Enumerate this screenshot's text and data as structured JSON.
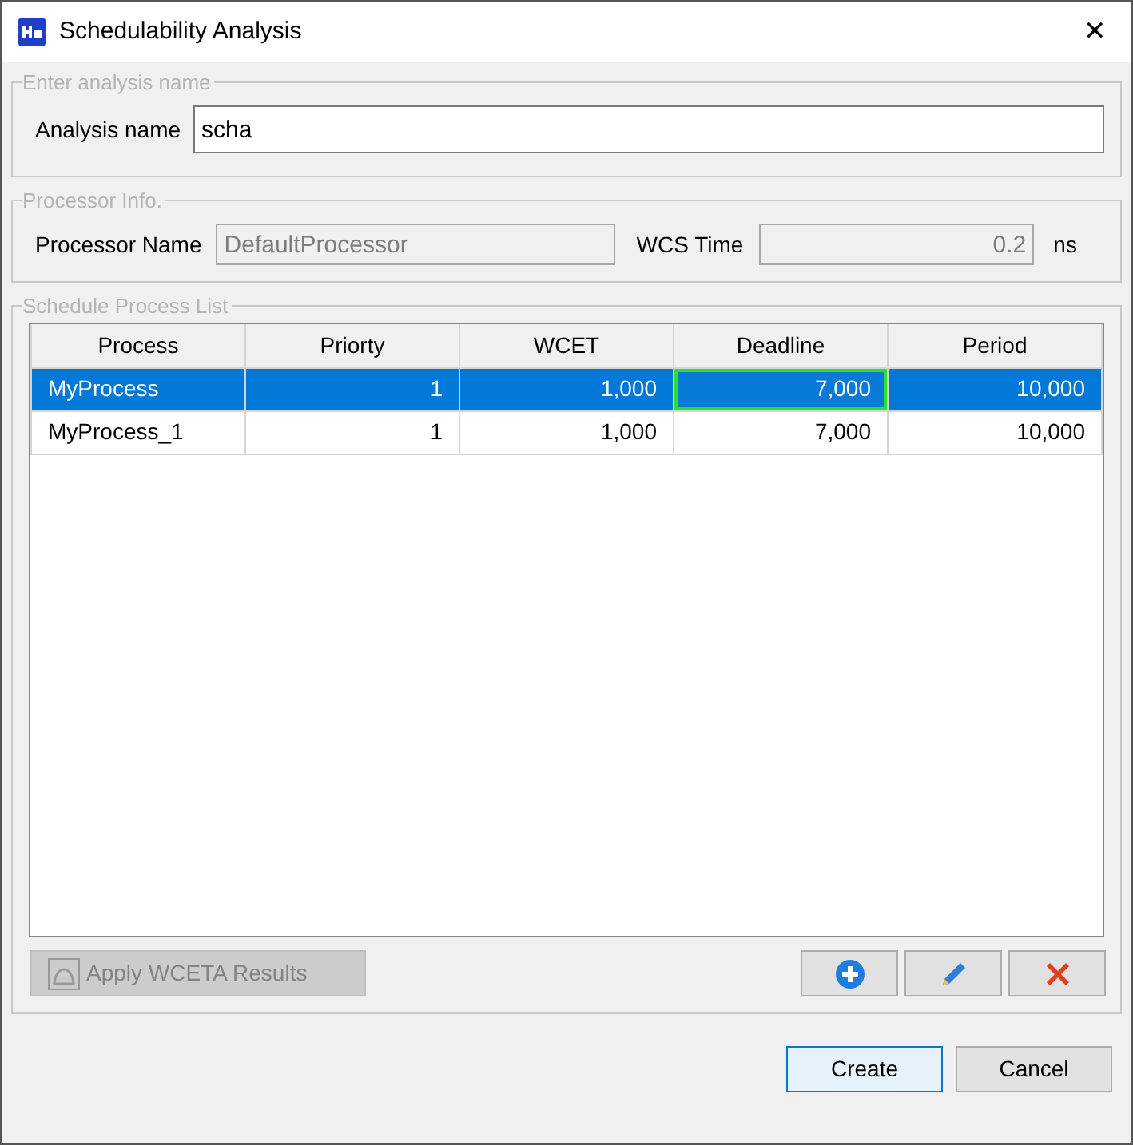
{
  "window": {
    "title": "Schedulability Analysis",
    "close": "✕"
  },
  "analysis_group": {
    "legend": "Enter analysis name",
    "label": "Analysis name",
    "value": "scha"
  },
  "processor_group": {
    "legend": "Processor Info.",
    "name_label": "Processor Name",
    "name_value": "DefaultProcessor",
    "name_disabled": true,
    "time_label": "WCS Time",
    "time_value": "0.2",
    "time_disabled": true,
    "unit": "ns"
  },
  "process_group": {
    "legend": "Schedule Process List",
    "table": {
      "columns": [
        "Process",
        "Priorty",
        "WCET",
        "Deadline",
        "Period"
      ],
      "rows": [
        {
          "cells": [
            {
              "text": "MyProcess",
              "focused": false
            },
            {
              "text": "1",
              "focused": false
            },
            {
              "text": "1,000",
              "focused": false
            },
            {
              "text": "7,000",
              "focused": true
            },
            {
              "text": "10,000",
              "focused": false
            }
          ],
          "selected": true
        },
        {
          "cells": [
            {
              "text": "MyProcess_1",
              "focused": false
            },
            {
              "text": "1",
              "focused": false
            },
            {
              "text": "1,000",
              "focused": false
            },
            {
              "text": "7,000",
              "focused": false
            },
            {
              "text": "10,000",
              "focused": false
            }
          ],
          "selected": false
        }
      ]
    },
    "apply_button": {
      "label": "Apply WCETA Results",
      "disabled": true
    }
  },
  "buttons": [
    {
      "label": "Create",
      "default": true
    },
    {
      "label": "Cancel",
      "default": false
    }
  ]
}
